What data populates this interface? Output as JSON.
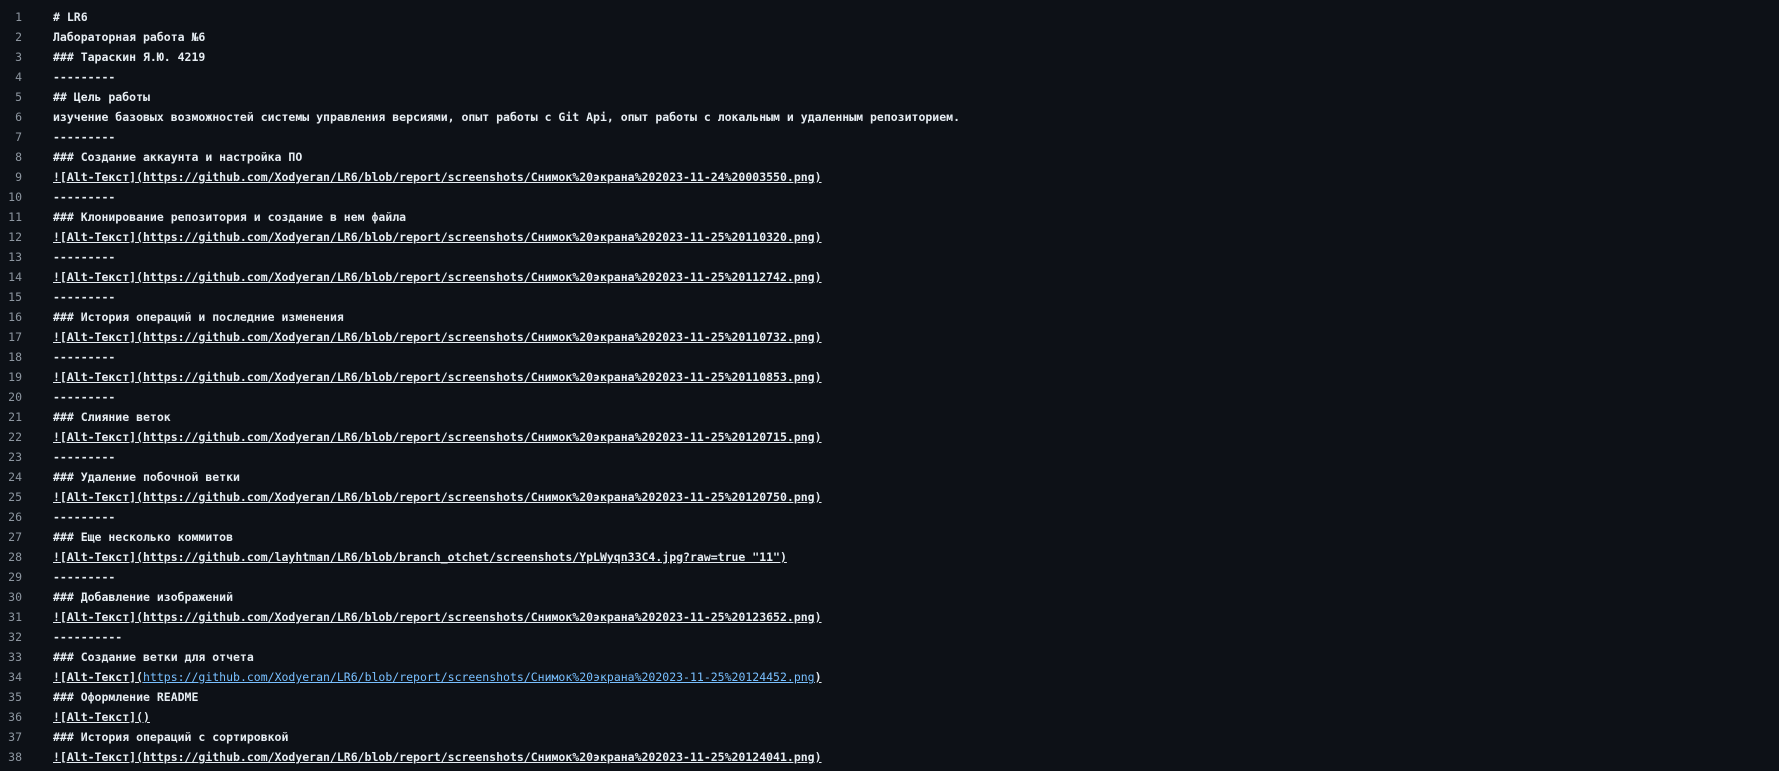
{
  "editor": {
    "lines": [
      {
        "n": "1",
        "text": "# LR6",
        "kind": "heading"
      },
      {
        "n": "2",
        "text": "Лабораторная работа №6",
        "kind": "text"
      },
      {
        "n": "3",
        "text": "### Тараскин Я.Ю. 4219",
        "kind": "heading"
      },
      {
        "n": "4",
        "text": "---------",
        "kind": "rule"
      },
      {
        "n": "5",
        "text": "## Цель работы",
        "kind": "heading"
      },
      {
        "n": "6",
        "text": "изучение базовых возможностей системы управления версиями, опыт работы с Git Api, опыт работы с локальным и удаленным репозиторием.",
        "kind": "text"
      },
      {
        "n": "7",
        "text": "---------",
        "kind": "rule"
      },
      {
        "n": "8",
        "text": "### Создание аккаунта и настройка ПО",
        "kind": "heading"
      },
      {
        "n": "9",
        "text": "![Alt-Текст](https://github.com/Xodyeran/LR6/blob/report/screenshots/Снимок%20экрана%202023-11-24%20003550.png)",
        "kind": "link"
      },
      {
        "n": "10",
        "text": "---------",
        "kind": "rule"
      },
      {
        "n": "11",
        "text": "### Клонирование репозитория и создание в нем файла",
        "kind": "heading"
      },
      {
        "n": "12",
        "text": "![Alt-Текст](https://github.com/Xodyeran/LR6/blob/report/screenshots/Снимок%20экрана%202023-11-25%20110320.png)",
        "kind": "link"
      },
      {
        "n": "13",
        "text": "---------",
        "kind": "rule"
      },
      {
        "n": "14",
        "text": "![Alt-Текст](https://github.com/Xodyeran/LR6/blob/report/screenshots/Снимок%20экрана%202023-11-25%20112742.png)",
        "kind": "link"
      },
      {
        "n": "15",
        "text": "---------",
        "kind": "rule"
      },
      {
        "n": "16",
        "text": "### История операций и последние изменения",
        "kind": "heading"
      },
      {
        "n": "17",
        "text": "![Alt-Текст](https://github.com/Xodyeran/LR6/blob/report/screenshots/Снимок%20экрана%202023-11-25%20110732.png)",
        "kind": "link"
      },
      {
        "n": "18",
        "text": "---------",
        "kind": "rule"
      },
      {
        "n": "19",
        "text": "![Alt-Текст](https://github.com/Xodyeran/LR6/blob/report/screenshots/Снимок%20экрана%202023-11-25%20110853.png)",
        "kind": "link"
      },
      {
        "n": "20",
        "text": "---------",
        "kind": "rule"
      },
      {
        "n": "21",
        "text": "### Слияние веток",
        "kind": "heading"
      },
      {
        "n": "22",
        "text": "![Alt-Текст](https://github.com/Xodyeran/LR6/blob/report/screenshots/Снимок%20экрана%202023-11-25%20120715.png)",
        "kind": "link"
      },
      {
        "n": "23",
        "text": "---------",
        "kind": "rule"
      },
      {
        "n": "24",
        "text": "### Удаление побочной ветки",
        "kind": "heading"
      },
      {
        "n": "25",
        "text": "![Alt-Текст](https://github.com/Xodyeran/LR6/blob/report/screenshots/Снимок%20экрана%202023-11-25%20120750.png)",
        "kind": "link"
      },
      {
        "n": "26",
        "text": "---------",
        "kind": "rule"
      },
      {
        "n": "27",
        "text": "### Еще несколько коммитов",
        "kind": "heading"
      },
      {
        "n": "28",
        "text": "![Alt-Текст](https://github.com/layhtman/LR6/blob/branch_otchet/screenshots/YpLWyqn33C4.jpg?raw=true \"11\")",
        "kind": "link"
      },
      {
        "n": "29",
        "text": "---------",
        "kind": "rule"
      },
      {
        "n": "30",
        "text": "### Добавление изображений",
        "kind": "heading"
      },
      {
        "n": "31",
        "text": "![Alt-Текст](https://github.com/Xodyeran/LR6/blob/report/screenshots/Снимок%20экрана%202023-11-25%20123652.png)",
        "kind": "link"
      },
      {
        "n": "32",
        "text": "----------",
        "kind": "rule"
      },
      {
        "n": "33",
        "text": "### Создание ветки для отчета",
        "kind": "heading"
      },
      {
        "n": "34",
        "text_prefix": "![Alt-Текст](",
        "text_link": "https://github.com/Xodyeran/LR6/blob/report/screenshots/Снимок%20экрана%202023-11-25%20124452.png",
        "text_suffix": ")",
        "kind": "link-split"
      },
      {
        "n": "35",
        "text": "### Оформление README",
        "kind": "heading"
      },
      {
        "n": "36",
        "text": "![Alt-Текст]()",
        "kind": "link"
      },
      {
        "n": "37",
        "text": "### История операций с сортировкой",
        "kind": "heading"
      },
      {
        "n": "38",
        "text": "![Alt-Текст](https://github.com/Xodyeran/LR6/blob/report/screenshots/Снимок%20экрана%202023-11-25%20124041.png)",
        "kind": "link"
      }
    ]
  },
  "colors": {
    "background": "#0d1117",
    "text": "#e6edf3",
    "line_number": "#8d96a0",
    "link_plain": "#79c0ff"
  }
}
